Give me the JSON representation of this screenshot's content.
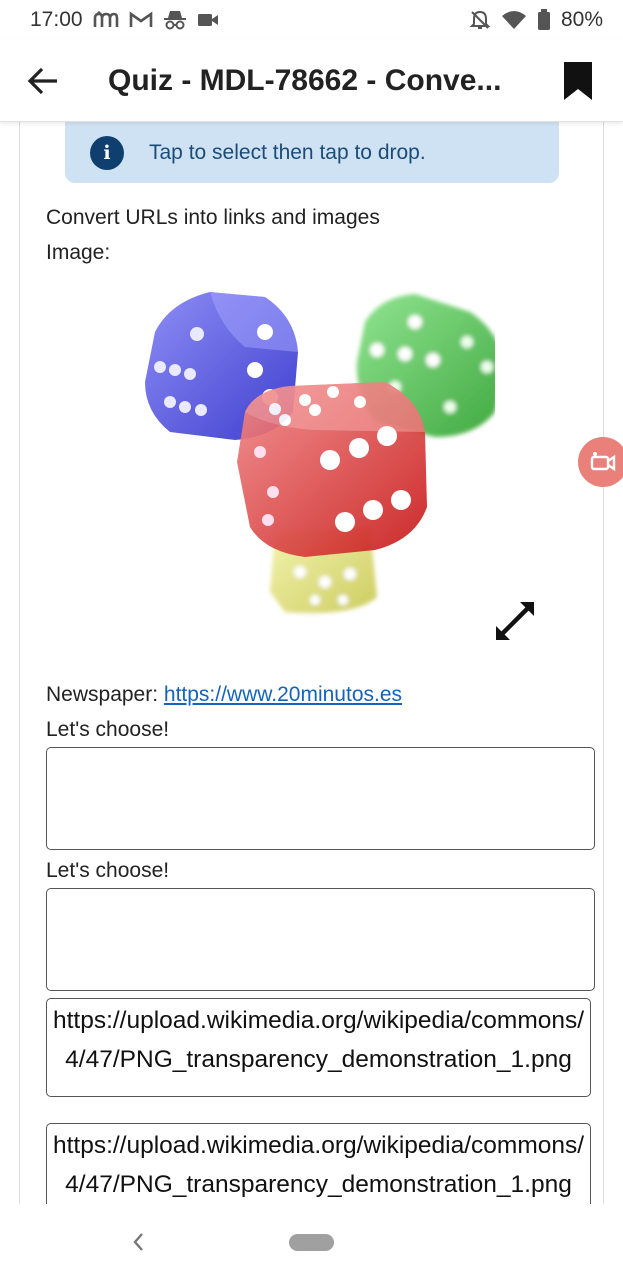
{
  "status_bar": {
    "time": "17:00",
    "battery": "80%",
    "left_icons": [
      "moodle-m-icon",
      "gmail-icon",
      "incognito-icon",
      "video-camera-icon"
    ],
    "right_icons": [
      "notifications-off-icon",
      "wifi-icon",
      "battery-icon"
    ]
  },
  "app_bar": {
    "title": "Quiz - MDL-78662 - Conve...",
    "back_icon": "arrow-back-icon",
    "bookmark_icon": "bookmark-icon"
  },
  "info": {
    "text": "Tap to select then tap to drop.",
    "icon": "info-icon"
  },
  "question": {
    "heading": "Convert URLs into links and images",
    "image_label": "Image:",
    "newspaper_label": "Newspaper:",
    "newspaper_link": "https://www.20minutos.es",
    "choose_1": "Let's choose!",
    "choose_2": "Let's choose!"
  },
  "drag_items": [
    "https://upload.wikimedia.org/wikipedia/commons/4/47/PNG_transparency_demonstration_1.png",
    "https://upload.wikimedia.org/wikipedia/commons/4/47/PNG_transparency_demonstration_1.png"
  ],
  "colors": {
    "info_bg": "#cfe2f3",
    "info_text": "#1d4b78",
    "link": "#1664b8",
    "float_button": "#e9807a"
  }
}
